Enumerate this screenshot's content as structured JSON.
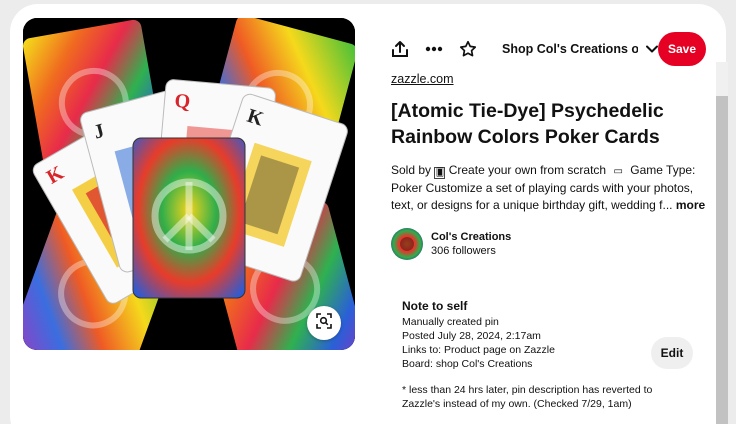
{
  "toolbar": {
    "board_name": "Shop Col's Creations on...",
    "save_label": "Save"
  },
  "pin": {
    "source": "zazzle.com",
    "title_line1": "[Atomic Tie-Dye] Psychedelic",
    "title_line2": "Rainbow Colors Poker Cards",
    "desc_line1_a": "Sold by",
    "desc_line1_b": "Create your own from scratch",
    "desc_line1_c": "Game Type:",
    "desc_line2": "Poker Customize a set of playing cards with your photos,",
    "desc_line3": "text, or designs for a unique birthday gift, wedding f...",
    "more_label": "more"
  },
  "creator": {
    "name": "Col's Creations",
    "followers": "306 followers"
  },
  "note": {
    "title": "Note to self",
    "lines": [
      "Manually created pin",
      "Posted July 28, 2024, 2:17am",
      "Links to: Product page on Zazzle",
      "Board: shop Col's Creations"
    ],
    "footnote_line1": "* less than 24 hrs later, pin description has reverted to",
    "footnote_line2": "Zazzle's instead of my own. (Checked 7/29, 1am)",
    "edit_label": "Edit"
  },
  "image": {
    "card_ranks": [
      "K",
      "J",
      "Q",
      "K",
      "K"
    ],
    "accent_colors": [
      "#e8342b",
      "#f2c418",
      "#36b24a",
      "#2b6cd6",
      "#8a3fc2"
    ]
  },
  "icons": [
    "share-icon",
    "more-icon",
    "star-icon",
    "chevron-down-icon",
    "visual-search-icon"
  ]
}
